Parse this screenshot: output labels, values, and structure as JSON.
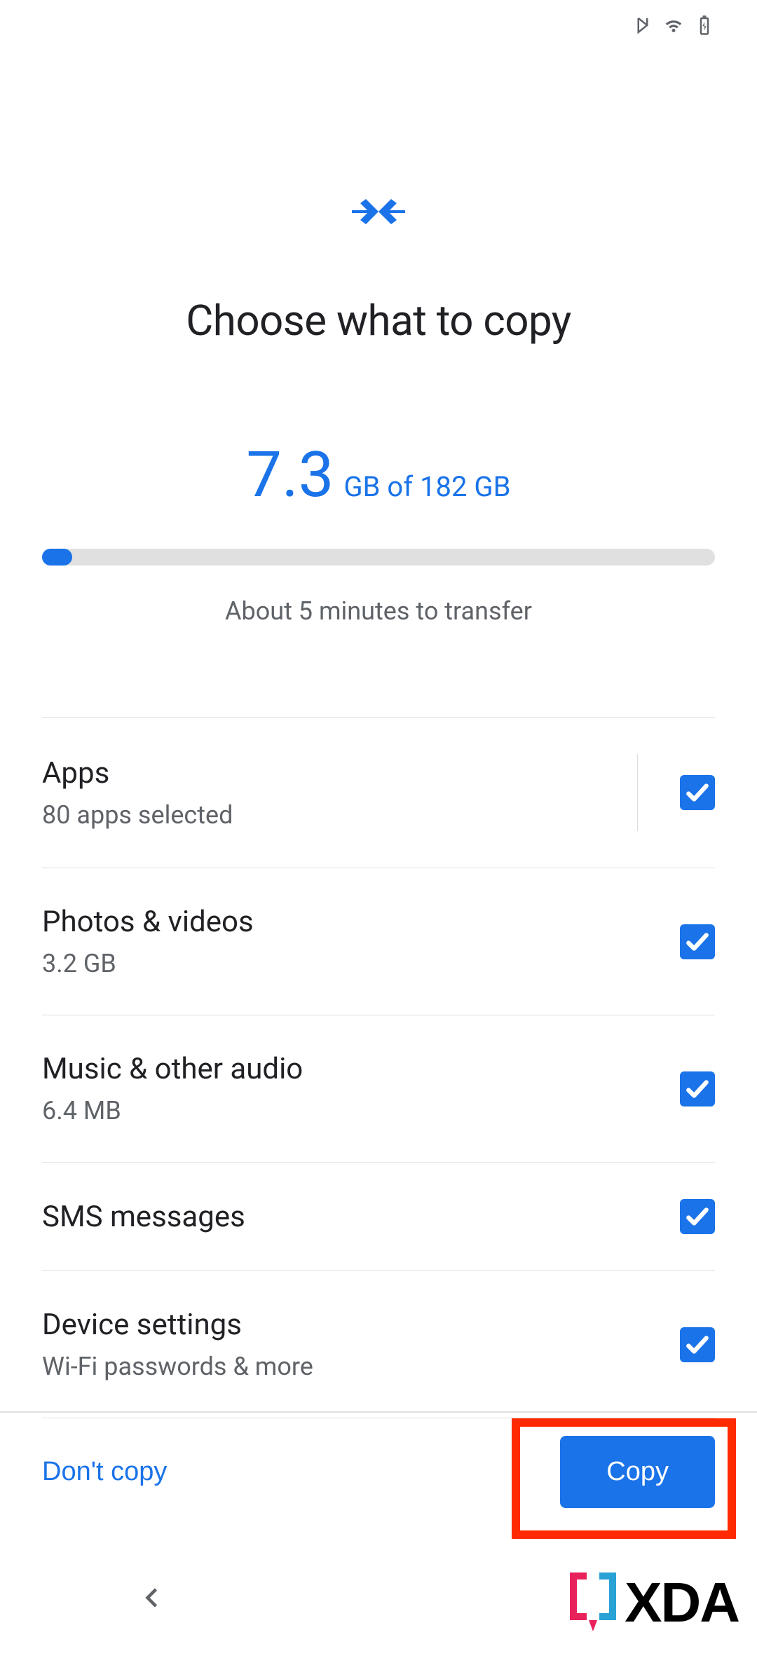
{
  "header": {
    "title": "Choose what to copy"
  },
  "summary": {
    "selected_size": "7.3",
    "size_unit": "GB",
    "of_word": "of",
    "total": "182 GB",
    "progress_percent": 4.5,
    "estimate": "About 5 minutes to transfer"
  },
  "items": [
    {
      "title": "Apps",
      "sub": "80 apps selected",
      "checked": true,
      "has_vsep": true
    },
    {
      "title": "Photos & videos",
      "sub": "3.2 GB",
      "checked": true,
      "has_vsep": false
    },
    {
      "title": "Music & other audio",
      "sub": "6.4 MB",
      "checked": true,
      "has_vsep": false
    },
    {
      "title": "SMS messages",
      "sub": "",
      "checked": true,
      "has_vsep": false
    },
    {
      "title": "Device settings",
      "sub": "Wi-Fi passwords & more",
      "checked": true,
      "has_vsep": false
    }
  ],
  "footer": {
    "dont_copy_label": "Don't copy",
    "copy_label": "Copy"
  },
  "watermark": {
    "text": "XDA"
  },
  "colors": {
    "accent": "#1a73e8",
    "highlight": "#ff2a00"
  }
}
